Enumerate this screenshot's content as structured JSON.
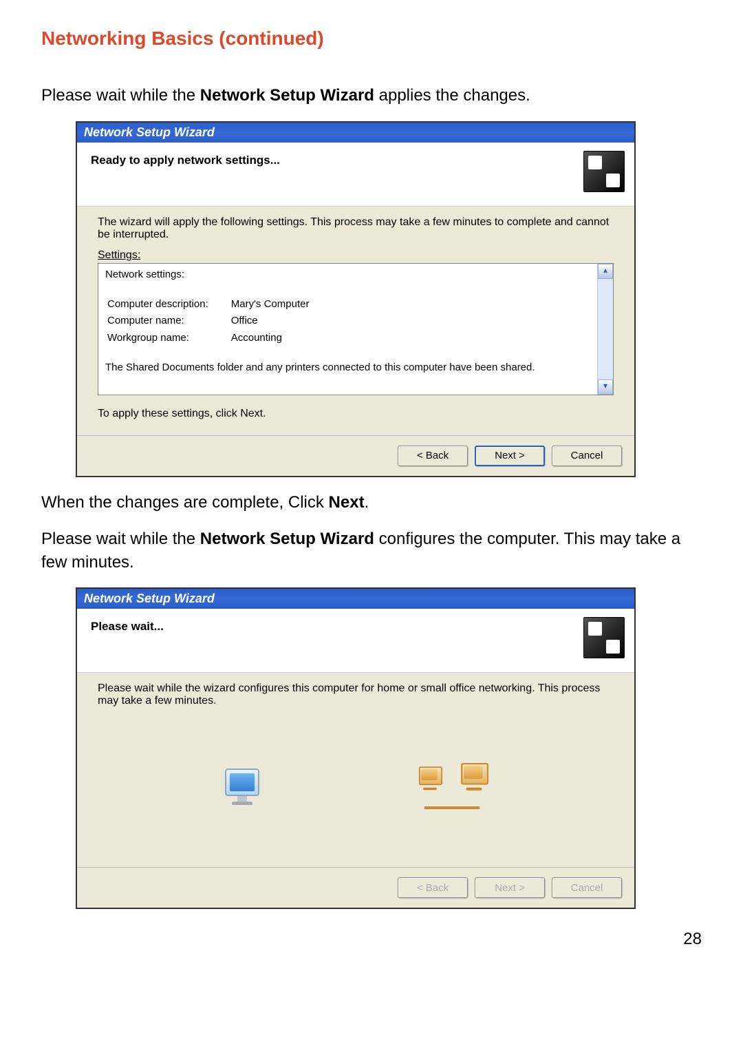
{
  "section_title": "Networking Basics (continued)",
  "intro1_a": "Please wait while the ",
  "intro1_b": "Network Setup Wizard",
  "intro1_c": " applies the changes.",
  "wizard1": {
    "titlebar": "Network Setup Wizard",
    "header": "Ready to apply network settings...",
    "para1": "The wizard will apply the following settings. This process may take a few minutes to complete and cannot be interrupted.",
    "settings_label": "Settings:",
    "settings_heading": "Network settings:",
    "rows": [
      {
        "label": "Computer description:",
        "value": "Mary's Computer"
      },
      {
        "label": "Computer name:",
        "value": "Office"
      },
      {
        "label": "Workgroup name:",
        "value": "Accounting"
      }
    ],
    "shared_text": "The Shared Documents folder and any printers connected to this computer have been shared.",
    "apply_text": "To apply these settings, click Next.",
    "buttons": {
      "back": "< Back",
      "next": "Next >",
      "cancel": "Cancel"
    }
  },
  "mid1_a": "When the changes are complete, Click ",
  "mid1_b": "Next",
  "mid1_c": ".",
  "mid2_a": "Please wait while the ",
  "mid2_b": "Network Setup Wizard",
  "mid2_c": " configures the computer. This may take a few minutes.",
  "wizard2": {
    "titlebar": "Network Setup Wizard",
    "header": "Please wait...",
    "para1": "Please wait while the wizard configures this computer for home or small office networking. This process may take a few minutes.",
    "buttons": {
      "back": "< Back",
      "next": "Next >",
      "cancel": "Cancel"
    }
  },
  "page_number": "28"
}
